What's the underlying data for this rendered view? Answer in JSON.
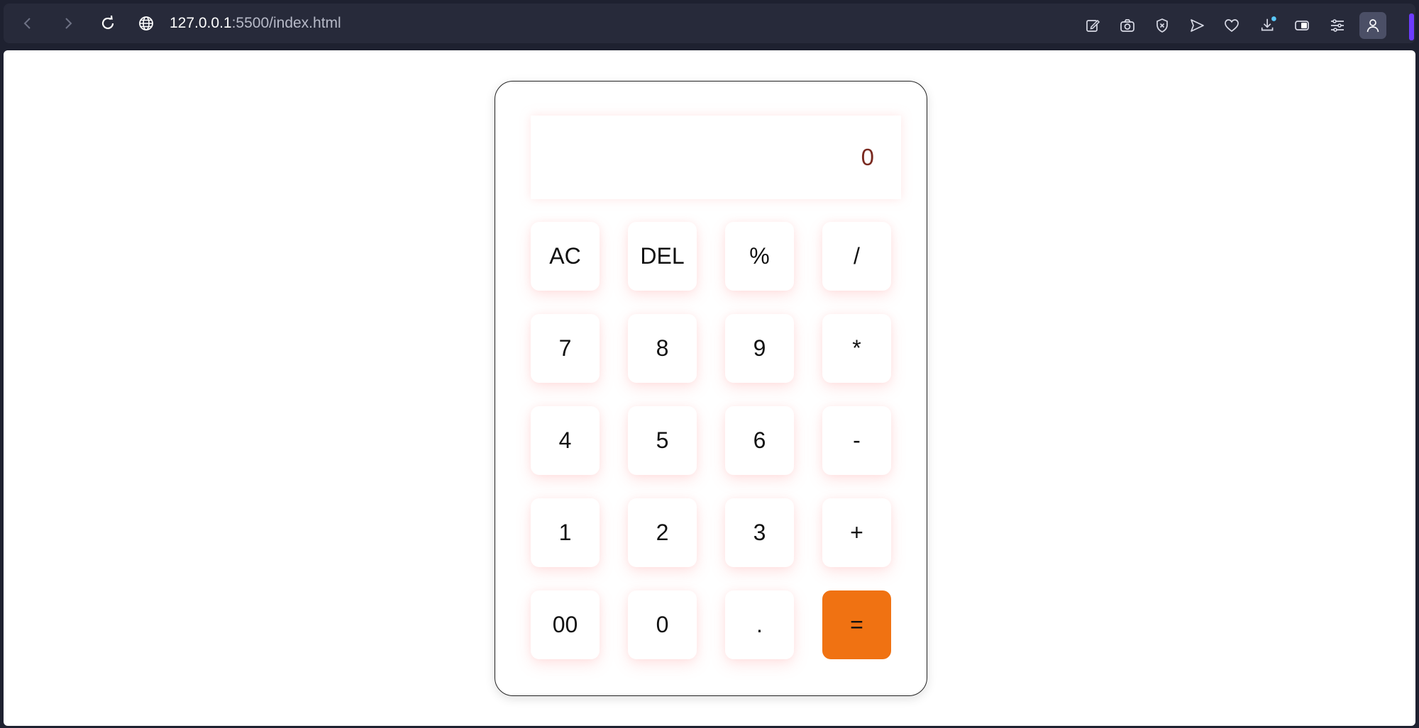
{
  "browser": {
    "url_host": "127.0.0.1",
    "url_path": ":5500/index.html",
    "icons": [
      "back-icon",
      "forward-icon",
      "reload-icon",
      "globe-icon",
      "edit-icon",
      "camera-icon",
      "shield-icon",
      "send-icon",
      "heart-icon",
      "download-icon",
      "battery-icon",
      "sliders-icon",
      "profile-icon"
    ],
    "accent_color": "#6d3cff"
  },
  "calculator": {
    "display_value": "0",
    "rows": [
      [
        "AC",
        "DEL",
        "%",
        "/"
      ],
      [
        "7",
        "8",
        "9",
        "*"
      ],
      [
        "4",
        "5",
        "6",
        "-"
      ],
      [
        "1",
        "2",
        "3",
        "+"
      ],
      [
        "00",
        "0",
        ".",
        "="
      ]
    ],
    "equals_color": "#f07212"
  }
}
